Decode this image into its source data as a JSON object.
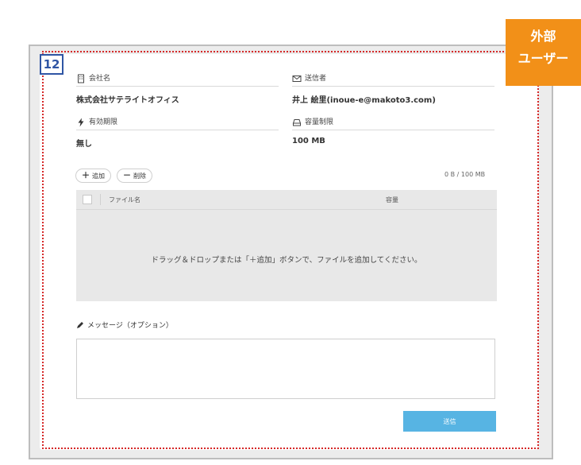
{
  "step_number": "12",
  "corner_tag": {
    "line1": "外部",
    "line2": "ユーザー"
  },
  "company": {
    "label": "会社名",
    "value": "株式会社サテライトオフィス",
    "icon": "building-icon"
  },
  "sender": {
    "label": "送信者",
    "value": "井上 絵里(inoue-e@makoto3.com)",
    "icon": "envelope-icon"
  },
  "expiry": {
    "label": "有効期限",
    "value": "無し",
    "icon": "bolt-icon"
  },
  "capacity": {
    "label": "容量制限",
    "value": "100 MB",
    "icon": "drive-icon"
  },
  "toolbar": {
    "add_label": "追加",
    "delete_label": "削除",
    "usage": "0 B / 100 MB"
  },
  "file_table": {
    "col_name": "ファイル名",
    "col_size": "容量",
    "empty_message": "ドラッグ＆ドロップまたは「＋追加」ボタンで、ファイルを追加してください。"
  },
  "message": {
    "label": "メッセージ（オプション）",
    "value": ""
  },
  "send_label": "送信",
  "colors": {
    "accent": "#57b4e3",
    "tag": "#f29018",
    "badge": "#2f55a4",
    "dotted_border": "#d62828"
  }
}
